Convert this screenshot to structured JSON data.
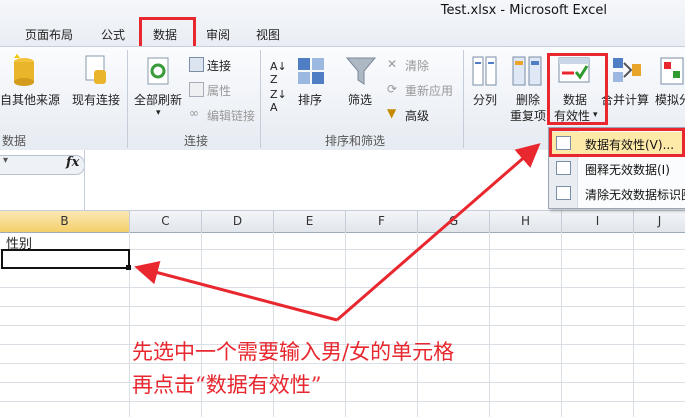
{
  "window": {
    "title": "Test.xlsx  -  Microsoft Excel"
  },
  "tabs": [
    "页面布局",
    "公式",
    "数据",
    "审阅",
    "视图"
  ],
  "ribbon": {
    "get_external": {
      "btn1": "自其他来源",
      "btn2": "现有连接",
      "group": "数据"
    },
    "connections": {
      "refresh_all": "全部刷新",
      "connections": "连接",
      "properties": "属性",
      "edit_links": "编辑链接",
      "group": "连接"
    },
    "sort_filter": {
      "sort": "排序",
      "filter": "筛选",
      "clear": "清除",
      "reapply": "重新应用",
      "advanced": "高级",
      "group": "排序和筛选"
    },
    "data_tools": {
      "text_to_columns": "分列",
      "remove_dup_1": "删除",
      "remove_dup_2": "重复项",
      "validation_1": "数据",
      "validation_2": "有效性",
      "consolidate": "合并计算",
      "what_if": "模拟分"
    }
  },
  "formula_bar": {
    "fx": "fx"
  },
  "columns": [
    "B",
    "C",
    "D",
    "E",
    "F",
    "G",
    "H",
    "I",
    "J"
  ],
  "cells": {
    "b1": "性别"
  },
  "dropdown": {
    "items": [
      "数据有效性(V)...",
      "圈释无效数据(I)",
      "清除无效数据标识圈"
    ]
  },
  "annotation": {
    "line1": "先选中一个需要输入男/女的单元格",
    "line2": "再点击“数据有效性”"
  },
  "colors": {
    "accent_red": "#e8272f"
  }
}
